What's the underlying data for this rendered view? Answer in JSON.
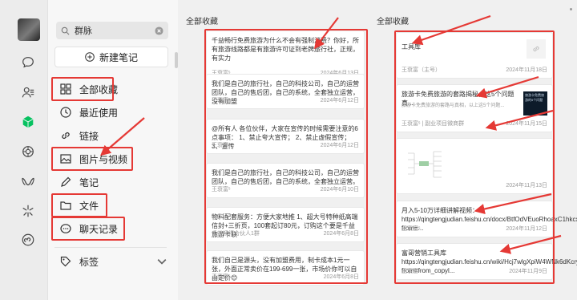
{
  "rail": {
    "icons": [
      "chat-icon",
      "contacts-icon",
      "favorites-icon",
      "moments-icon",
      "channels-icon",
      "search-icon",
      "miniprogram-icon"
    ]
  },
  "nav": {
    "search_value": "群脉",
    "new_note_label": "新建笔记",
    "items": [
      {
        "label": "全部收藏",
        "icon": "grid-icon"
      },
      {
        "label": "最近使用",
        "icon": "clock-icon"
      },
      {
        "label": "链接",
        "icon": "link-icon"
      },
      {
        "label": "图片与视频",
        "icon": "image-icon"
      },
      {
        "label": "笔记",
        "icon": "note-icon"
      },
      {
        "label": "文件",
        "icon": "folder-icon"
      },
      {
        "label": "聊天记录",
        "icon": "chat-record-icon"
      },
      {
        "label": "标签",
        "icon": "tag-icon"
      }
    ]
  },
  "middle": {
    "title": "全部收藏",
    "cards": [
      {
        "text": "千益畅行免费旅游为什么不会有强制消费？你好，所有旅游线路都是有旅游许可证到老牌旅行社，正规，有实力",
        "source": "王衰富ˢ",
        "date": "2024年6月13日"
      },
      {
        "text": "我们是自己的旅行社，自己的科技公司，自己的运营团队，自己的售后团，自己的系统，全套独立运营， 没有加盟",
        "source": "王衰富ˢ",
        "date": "2024年6月12日"
      },
      {
        "text": "@所有人 各位伙伴，大家在宣传的时候需要注意的6点事项： 1、禁止夸大宣传； 2、禁止虚假宣传； 3、宣传",
        "source": "王衰富ˢ",
        "date": "2024年6月12日"
      },
      {
        "text": "我们是自己的旅行社，自己的科技公司，自己的运营团队，自己的售后团，自己的系统，全套独立运营。",
        "source": "王衰富ˢ",
        "date": "2024年6月10日"
      },
      {
        "text": "物料配套服务：方便大家地推 1、超大号特种纸高端信封+三折页，100套起订80元，订购这个要是千益旅游卡联",
        "source": "千益畅行合伙人1群",
        "date": "2024年6月8日"
      },
      {
        "text": "我们自己是源头，没有加盟费用，制卡成本1元一张，外面正常卖价在199-699一张，市场价你可以自由定价😊",
        "source": "王衰富ˢ",
        "date": "2024年6月8日"
      }
    ]
  },
  "right": {
    "title": "全部收藏",
    "cards": [
      {
        "title": "工具库",
        "source": "王衰富（主号）",
        "date": "2024年11月18日",
        "icon": "link-icon"
      },
      {
        "title": "旅游卡免费旅游的套路揭秘，这5个问题真...",
        "sub": "旅游卡免费旅游的套路与真相，以上这5个问题...",
        "source": "王衰富ˢ",
        "group": "副业项目微商群",
        "date": "2024年11月15日",
        "thumb_text": "旅游卡免费旅游的5个问题"
      },
      {
        "date": "2024年11月13日"
      },
      {
        "text": "月入5-10万详细讲解视频：https://qingtengjudian.feishu.cn/docx/BtfOdVEuoRhoaxC1hkcxhC9nse?from=...",
        "source": "王衰富ˢ",
        "date": "2024年11月12日"
      },
      {
        "text": "富哥营销工具库 https://qingtengjudian.feishu.cn/wiki/Hcj7wlgXpiW4WNk6dKcryc8n7g?from=from_copyl...",
        "source": "王衰富ˢ",
        "date": "2024年11月9日"
      }
    ]
  },
  "colors": {
    "highlight": "#e53935",
    "accent": "#07c160"
  }
}
